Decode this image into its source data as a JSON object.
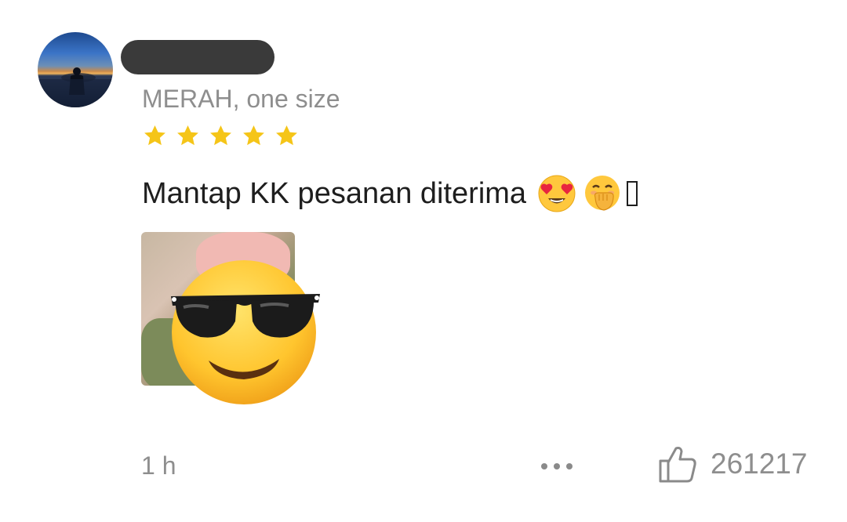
{
  "review": {
    "variant": "MERAH, one size",
    "rating": 5,
    "rating_max": 5,
    "text": "Mantap KK pesanan diterima",
    "emojis": [
      "smiling-face-with-heart-eyes",
      "face-with-hand-over-mouth",
      "unrendered-glyph"
    ],
    "photo_overlay_emoji": "smiling-face-with-sunglasses",
    "time": "1 h",
    "like_count": "261217"
  },
  "icons": {
    "more": "more-dots-icon",
    "like": "thumbs-up-icon",
    "star": "star-icon"
  },
  "colors": {
    "star": "#F5C518",
    "secondary_text": "#8E8E8E",
    "primary_text": "#1E1E1E",
    "redaction": "#3A3A3A"
  }
}
